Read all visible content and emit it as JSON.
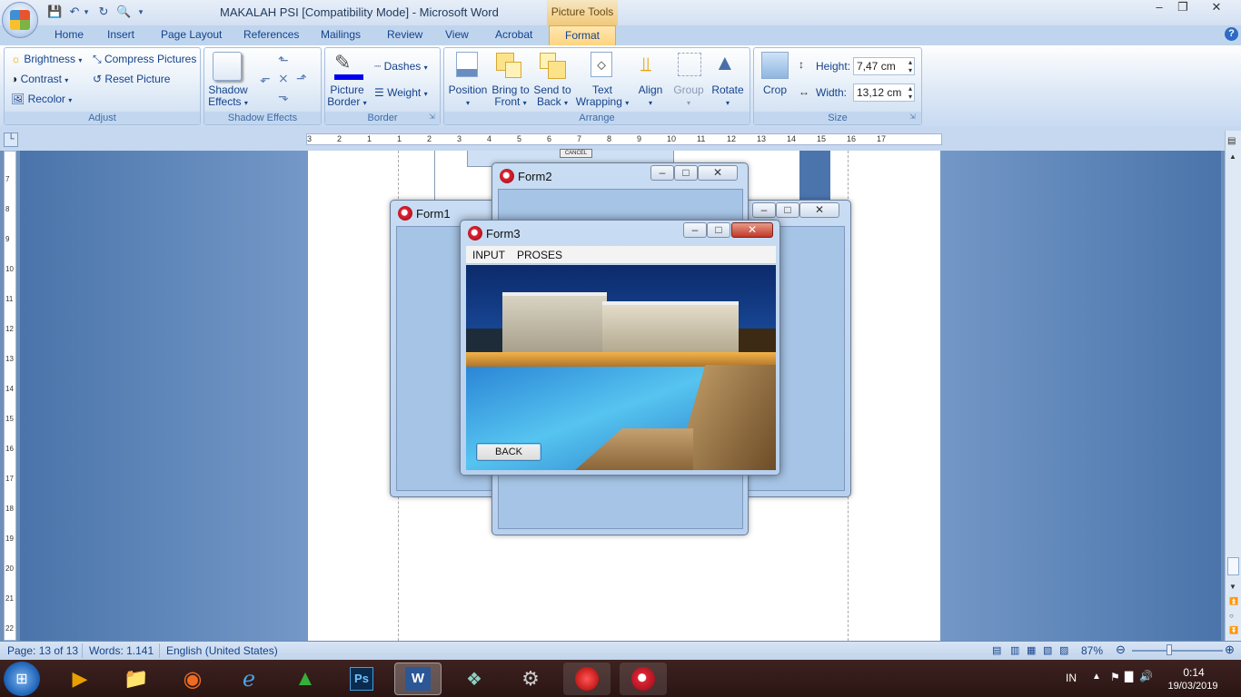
{
  "window": {
    "title": "MAKALAH PSI [Compatibility Mode] - Microsoft Word",
    "contextual_tab": "Picture Tools"
  },
  "tabs": [
    "Home",
    "Insert",
    "Page Layout",
    "References",
    "Mailings",
    "Review",
    "View",
    "Acrobat",
    "Format"
  ],
  "ribbon": {
    "adjust": {
      "brightness": "Brightness",
      "contrast": "Contrast",
      "recolor": "Recolor",
      "compress": "Compress Pictures",
      "reset": "Reset Picture",
      "label": "Adjust"
    },
    "shadow": {
      "btn1": "Shadow",
      "btn2": "Effects",
      "label": "Shadow Effects"
    },
    "border": {
      "pb1": "Picture",
      "pb2": "Border",
      "dashes": "Dashes",
      "weight": "Weight",
      "label": "Border"
    },
    "arrange": {
      "position": "Position",
      "bring1": "Bring to",
      "bring2": "Front",
      "send1": "Send to",
      "send2": "Back",
      "wrap1": "Text",
      "wrap2": "Wrapping",
      "align": "Align",
      "group": "Group",
      "rotate": "Rotate",
      "label": "Arrange"
    },
    "size": {
      "crop": "Crop",
      "height_label": "Height:",
      "height_value": "7,47 cm",
      "width_label": "Width:",
      "width_value": "13,12 cm",
      "label": "Size"
    }
  },
  "ruler": {
    "ticks": [
      "3",
      "2",
      "1",
      "1",
      "2",
      "3",
      "4",
      "5",
      "6",
      "7",
      "8",
      "9",
      "10",
      "11",
      "12",
      "13",
      "14",
      "15",
      "16",
      "17"
    ],
    "vticks": [
      "7",
      "8",
      "9",
      "10",
      "11",
      "12",
      "13",
      "14",
      "15",
      "16",
      "17",
      "18",
      "19",
      "20",
      "21",
      "22"
    ]
  },
  "forms": {
    "form1": {
      "title": "Form1"
    },
    "form2": {
      "title": "Form2",
      "cancel": "CANCEL"
    },
    "form3": {
      "title": "Form3",
      "menu": [
        "INPUT",
        "PROSES"
      ],
      "back": "BACK"
    }
  },
  "status": {
    "page": "Page: 13 of 13",
    "words": "Words: 1.141",
    "lang": "English (United States)",
    "zoom": "87%"
  },
  "taskbar": {
    "lang": "IN",
    "time": "0:14",
    "date": "19/03/2019"
  },
  "colors": {
    "accent": "#15428b",
    "format_tab": "#fdd47f",
    "taskbar": "#2a1513"
  }
}
